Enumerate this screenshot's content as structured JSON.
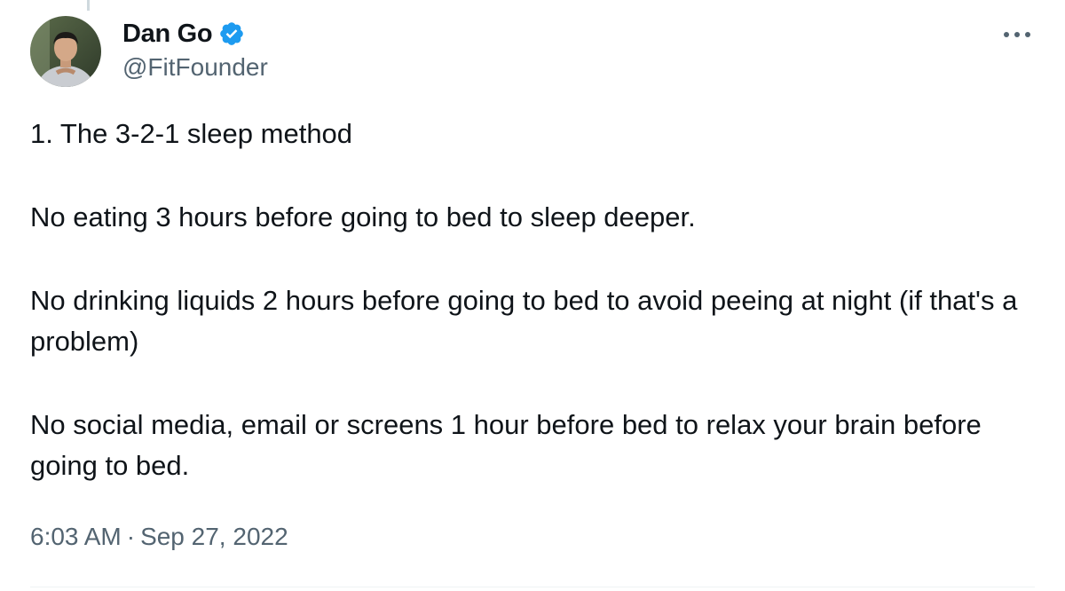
{
  "author": {
    "display_name": "Dan Go",
    "handle": "@FitFounder",
    "verified": true
  },
  "tweet": {
    "lines": [
      "1. The 3-2-1 sleep method",
      "No eating 3 hours before going to bed to sleep deeper.",
      "No drinking liquids 2 hours before going to bed to avoid peeing at night (if that's a problem)",
      "No social media, email or screens 1 hour before bed to relax your brain before going to bed."
    ],
    "time": "6:03 AM",
    "separator": "·",
    "date": "Sep 27, 2022"
  },
  "icons": {
    "verified": "verified-badge-icon",
    "more": "more-options-icon"
  },
  "colors": {
    "verified_blue": "#1d9bf0",
    "text": "#0f1419",
    "secondary": "#536471"
  }
}
